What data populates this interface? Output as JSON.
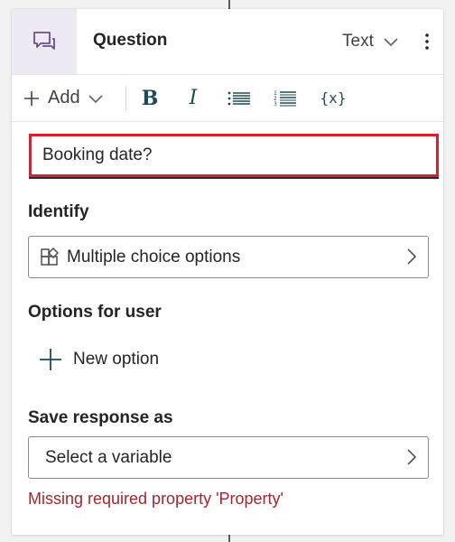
{
  "header": {
    "title": "Question",
    "type_value": "Text",
    "node_icon": "chat-bubbles-icon",
    "more_icon": "more-vertical-icon"
  },
  "toolbar": {
    "add_label": "Add",
    "bold_label": "B",
    "italic_label": "I",
    "bullets_icon": "bulleted-list-icon",
    "numbered_icon": "numbered-list-icon",
    "variable_label": "{x}"
  },
  "message": {
    "value": "Booking date?"
  },
  "identify": {
    "label": "Identify",
    "value": "Multiple choice options",
    "icon": "shapes-icon"
  },
  "options": {
    "label": "Options for user",
    "new_option_label": "New option"
  },
  "save_response": {
    "label": "Save response as",
    "placeholder": "Select a variable",
    "error": "Missing required property 'Property'"
  },
  "colors": {
    "error_border": "#d72030",
    "error_text": "#a4262c",
    "icon_box_bg": "#eeeaf4",
    "accent_icon": "#6b4f8a",
    "toolbar_icon": "#1a4a5c"
  }
}
